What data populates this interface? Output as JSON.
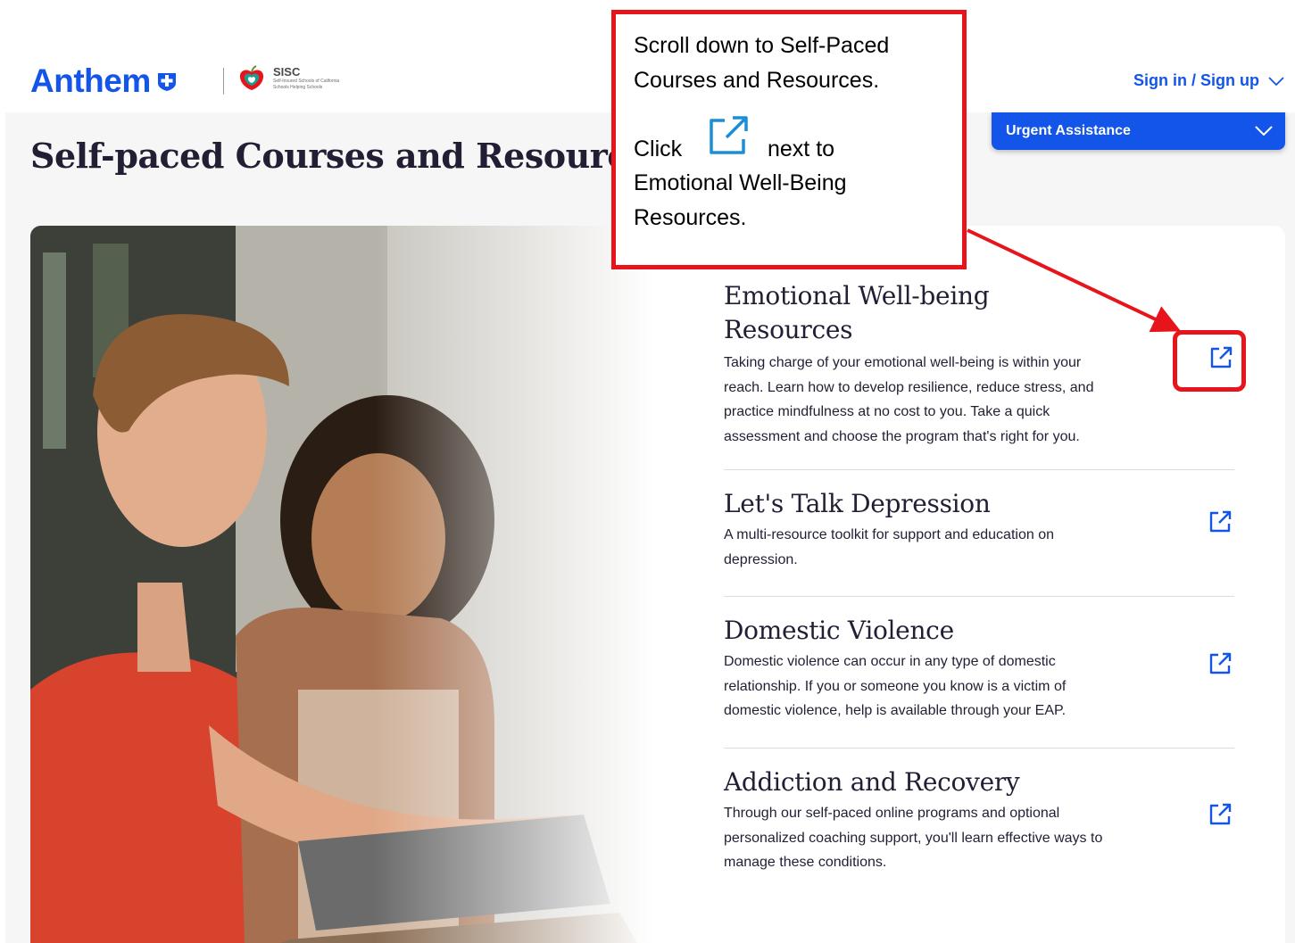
{
  "header": {
    "brand_name": "Anthem",
    "partner_name": "SISC",
    "partner_subtitle_1": "Self-Insured Schools of California",
    "partner_subtitle_2": "Schools Helping Schools",
    "sign_in_label": "Sign in / Sign up"
  },
  "urgent_assistance": {
    "label": "Urgent Assistance"
  },
  "page": {
    "title": "Self-paced Courses and Resources"
  },
  "resources": [
    {
      "title_line1": "Emotional Well-being",
      "title_line2": "Resources",
      "description": "Taking charge of your emotional well-being is within your reach. Learn how to develop resilience, reduce stress, and practice mindfulness at no cost to you. Take a quick assessment and choose the program that's right for you.",
      "link_icon": "external-link-icon"
    },
    {
      "title_line1": "Let's Talk Depression",
      "description": "A multi-resource toolkit for support and education on depression.",
      "link_icon": "external-link-icon"
    },
    {
      "title_line1": "Domestic Violence",
      "description": "Domestic violence can occur in any type of domestic relationship. If you or someone you know is a victim of domestic violence, help is available through your EAP.",
      "link_icon": "external-link-icon"
    },
    {
      "title_line1": "Addiction and Recovery",
      "description": "Through our self-paced online programs and optional personalized coaching support, you'll learn effective ways to manage these conditions.",
      "link_icon": "external-link-icon"
    }
  ],
  "callout": {
    "line1": "Scroll down to Self-Paced",
    "line2": "Courses and Resources.",
    "line3_a": "Click",
    "line3_b": "next to",
    "line4": "Emotional Well-Being",
    "line5": "Resources."
  },
  "colors": {
    "brand_blue": "#1355e9",
    "text_dark": "#231e33",
    "callout_red": "#e8141c",
    "background_grey": "#f6f6f6"
  }
}
